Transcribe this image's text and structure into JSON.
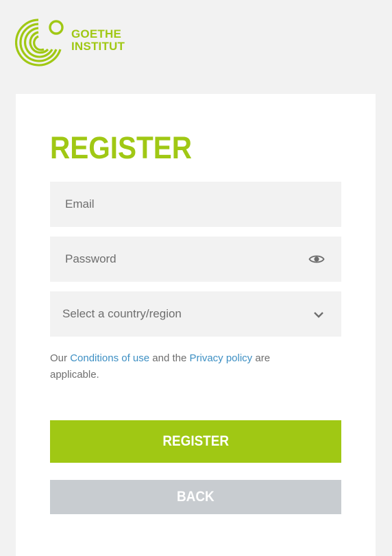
{
  "logo": {
    "line1": "GOETHE",
    "line2": "INSTITUT",
    "color": "#a0c814"
  },
  "form": {
    "title": "REGISTER",
    "email_placeholder": "Email",
    "password_placeholder": "Password",
    "password_toggle_icon": "eye-icon",
    "country_select": {
      "value": "Select a country/region",
      "icon": "chevron-down-icon"
    },
    "terms": {
      "prefix": "Our ",
      "conditions_link": "Conditions of use",
      "middle": " and the ",
      "privacy_link": "Privacy policy",
      "suffix": " are applicable."
    },
    "register_button": "REGISTER",
    "back_button": "BACK"
  },
  "colors": {
    "accent": "#a0c814",
    "link": "#3d8fc3",
    "field_bg": "#f2f2f2",
    "back_button_bg": "#c8ccd0",
    "page_bg": "#f2f2f2"
  }
}
